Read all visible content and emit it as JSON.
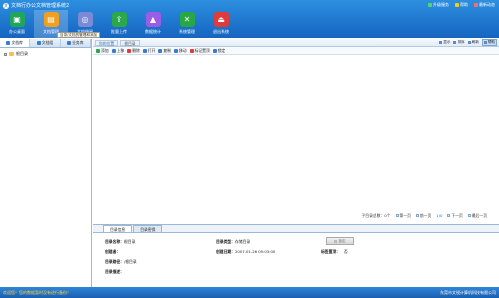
{
  "app": {
    "title": "文档行办公文档管理系统2",
    "window_links": [
      {
        "label": "升级服务",
        "color": "#4cd964"
      },
      {
        "label": "帮助",
        "color": "#ffcc00"
      },
      {
        "label": "最新动态",
        "color": "#ff6b6b"
      }
    ]
  },
  "toolbar": {
    "items": [
      {
        "label": "办公桌面",
        "icon": "desktop-icon",
        "glyph": "▣",
        "color": "#1fa65a"
      },
      {
        "label": "文档管理",
        "icon": "document-management-icon",
        "glyph": "▤",
        "color": "#f0a020"
      },
      {
        "label": "文档借阅",
        "icon": "borrow-icon",
        "glyph": "◎",
        "color": "#7a8ad8"
      },
      {
        "label": "批量上传",
        "icon": "upload-icon",
        "glyph": "⇪",
        "color": "#2aa84a"
      },
      {
        "label": "数据统计",
        "icon": "statistics-icon",
        "glyph": "▲",
        "color": "#9b5de5"
      },
      {
        "label": "系统管理",
        "icon": "settings-icon",
        "glyph": "✕",
        "color": "#28a745"
      },
      {
        "label": "退出系统",
        "icon": "exit-icon",
        "glyph": "⏏",
        "color": "#e03a3a"
      }
    ],
    "tooltip": "目录/文档的管理和添加"
  },
  "left_tabs": [
    {
      "label": "文档库"
    },
    {
      "label": "文档组"
    },
    {
      "label": "业务库"
    }
  ],
  "tree": {
    "root_label": "根目录"
  },
  "breadcrumb": [
    "你的位置",
    "根目录"
  ],
  "view_tools": [
    {
      "label": "显示"
    },
    {
      "label": "排序"
    },
    {
      "label": "刷新"
    },
    {
      "label": "帮助"
    }
  ],
  "actions": [
    {
      "label": "添加",
      "color": "#2aa84a"
    },
    {
      "label": "上移",
      "color": "#3a7bd5"
    },
    {
      "label": "删除",
      "color": "#e03a3a"
    },
    {
      "label": "打开",
      "color": "#3a7bd5"
    },
    {
      "label": "复制",
      "color": "#3a7bd5"
    },
    {
      "label": "移动",
      "color": "#3a7bd5"
    },
    {
      "label": "标记置顶",
      "color": "#e03a3a"
    },
    {
      "label": "锁定",
      "color": "#3a7bd5"
    }
  ],
  "pager": {
    "count_text": "子目录总数：0个",
    "first": "第一页",
    "prev": "前一页",
    "page": "1/0",
    "next": "下一页",
    "last": "最后一页"
  },
  "detail": {
    "tabs": [
      "目录信息",
      "目录密保"
    ],
    "name_label": "目录名称：",
    "name_value": "根目录",
    "type_label": "目录类型：",
    "type_value": "存储目录",
    "creator_label": "创建者：",
    "created_label": "创建日期：",
    "created_value": "2007-01-26 05:03:00",
    "flag_label": "标签置顶：",
    "flag_value": "否",
    "path_label": "目录路径：",
    "path_value": "/根目录",
    "desc_label": "目录描述：",
    "button_label": "锁定"
  },
  "status": {
    "left": "欢迎您！您的数据暂时没有进行备份！",
    "right": "东莞市文锐计算机科技有限公司"
  }
}
